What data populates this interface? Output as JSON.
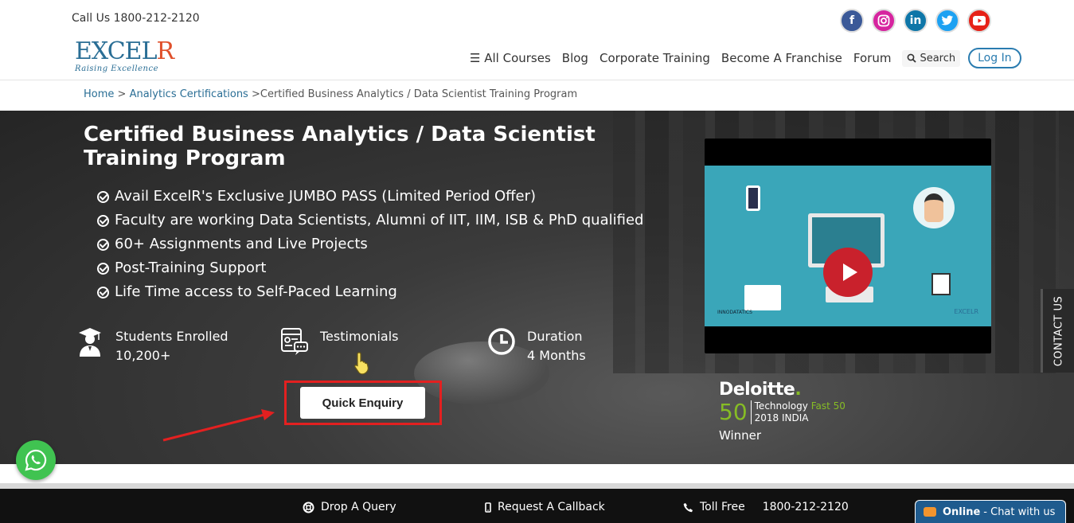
{
  "header": {
    "call_us": "Call Us 1800-212-2120",
    "logo_main": "EXCEL",
    "logo_r": "R",
    "logo_tagline": "Raising Excellence",
    "social": [
      "facebook",
      "instagram",
      "linkedin",
      "twitter",
      "youtube"
    ],
    "nav": {
      "all_courses": "All Courses",
      "blog": "Blog",
      "corporate": "Corporate Training",
      "franchise": "Become A Franchise",
      "forum": "Forum",
      "search": "Search",
      "login": "Log In"
    }
  },
  "breadcrumb": {
    "home": "Home",
    "sep1": " > ",
    "analytics": "Analytics Certifications",
    "sep2": " >",
    "current": "Certified Business Analytics / Data Scientist Training Program"
  },
  "hero": {
    "title": "Certified Business Analytics / Data Scientist Training Program",
    "features": [
      "Avail ExcelR's Exclusive JUMBO PASS (Limited Period Offer)",
      "Faculty are working Data Scientists, Alumni of IIT, IIM, ISB & PhD qualified",
      "60+ Assignments and Live Projects",
      "Post-Training Support",
      "Life Time access to Self-Paced Learning"
    ],
    "stats": {
      "students_label": "Students Enrolled",
      "students_value": "10,200+",
      "testimonials_label": "Testimonials",
      "duration_label": "Duration",
      "duration_value": "4 Months"
    },
    "quick_enquiry": "Quick Enquiry",
    "video": {
      "brand_left": "INNODATATICS",
      "brand_right": "EXCELR"
    },
    "award": {
      "company": "Deloitte",
      "number": "50",
      "line1_a": "Technology ",
      "line1_b": "Fast 50",
      "line2": "2018 INDIA",
      "winner": "Winner"
    },
    "contact_tab": "CONTACT US"
  },
  "footer": {
    "drop_query": "Drop A Query",
    "callback": "Request A Callback",
    "toll_free": "Toll Free",
    "toll_number": "1800-212-2120",
    "chat_status": "Online",
    "chat_text": "- Chat with us"
  },
  "colors": {
    "brand_blue": "#2a6e95",
    "brand_orange": "#e0502b",
    "highlight_red": "#e32020",
    "deloitte_green": "#86bc25"
  }
}
